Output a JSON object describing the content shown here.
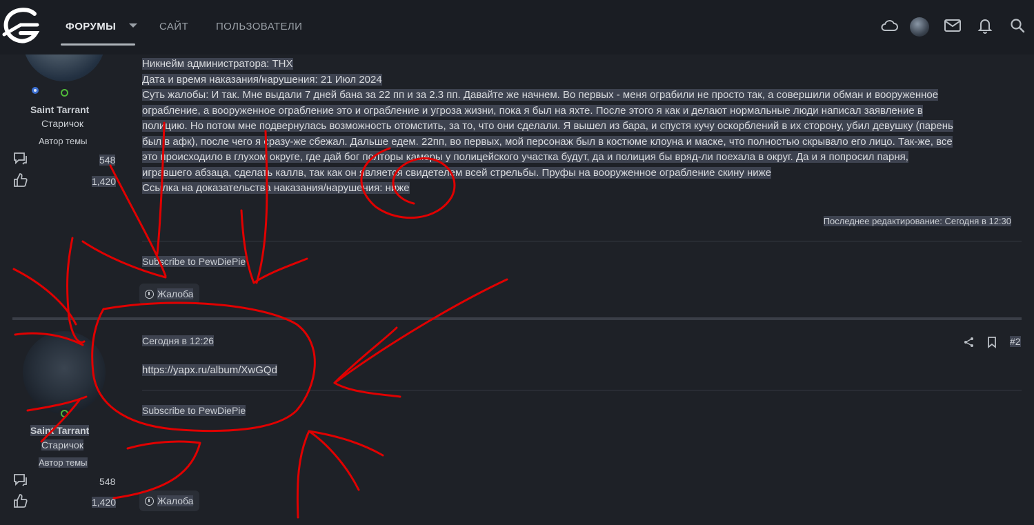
{
  "nav": {
    "forums": "ФОРУМЫ",
    "site": "САЙТ",
    "users": "ПОЛЬЗОВАТЕЛИ"
  },
  "icons": {
    "logo": "logo-icon",
    "cloud": "cloud-icon",
    "mail": "mail-icon",
    "bell": "bell-icon",
    "search": "search-icon",
    "messages": "speech-bubble-icon",
    "likes": "thumbs-up-icon",
    "share": "share-icon",
    "bookmark": "bookmark-icon",
    "report": "alert-circle-icon"
  },
  "colors": {
    "background": "#1e2127",
    "topbar": "#1a1d23",
    "selection": "#3e4350",
    "online": "#4fb83a",
    "annotation": "#e00000"
  },
  "post1": {
    "author": {
      "name": "Saint Tarrant",
      "title": "Старичок",
      "badge": "Автор темы",
      "messages": "548",
      "reactions": "1,420"
    },
    "lines": [
      "Никнейм администратора: THX",
      "Дата и время наказания/нарушения: 21 Июл 2024",
      "Суть жалобы: И так. Мне выдали 7 дней бана за 22 пп и за 2.3 пп. Давайте же начнем. Во первых - меня ограбили не просто так, а совершили обман и вооруженное",
      "ограбление, а вооруженное ограбление это и ограбление и угроза жизни, пока я был на яхте. После этого я как и делают нормальные люди написал заявление в",
      "полицию. Но потом мне подвернулась возможность отомстить, за то, что они сделали. Я вышел из бара, и спустя кучу оскорблений в их сторону, убил девушку (парень",
      "был в афк), после чего я сразу-же сбежал. Дальше едем. 22пп, во первых, мой персонаж был в костюме клоуна и маске, что полностью скрывало его лицо. Так-же, все",
      "это происходило в глухом округе, где дай бог полторы камеры у полицейского участка будут, да и полиция бы вряд-ли поехала в округ. Да и я попросил парня,",
      "игравшего абзацa, сделать каллв, так как он является свидетелем всей стрельбы. Пруфы на вооруженное ограбление скину ниже",
      "Ссылка на доказательства наказания/нарушения: ниже"
    ],
    "edited": "Последнее редактирование: Сегодня в 12:30",
    "signature": "Subscribe to PewDiePie",
    "report": "Жалоба"
  },
  "post2": {
    "author": {
      "name": "Saint Tarrant",
      "title": "Старичок",
      "badge": "Автор темы",
      "messages": "548",
      "reactions": "1,420"
    },
    "date": "Сегодня в 12:26",
    "link": "https://yapx.ru/album/XwGQd",
    "number": "#2",
    "signature": "Subscribe to PewDiePie",
    "report": "Жалоба"
  }
}
